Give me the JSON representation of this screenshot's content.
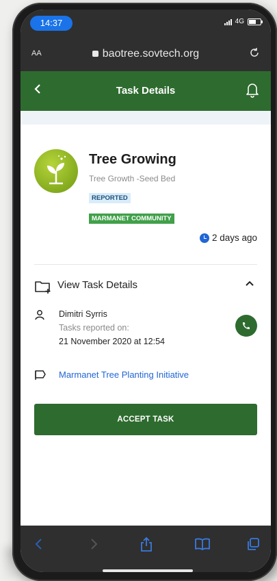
{
  "status_bar": {
    "time": "14:37",
    "network": "4G"
  },
  "browser": {
    "text_size_label": "AA",
    "url": "baotree.sovtech.org"
  },
  "header": {
    "title": "Task Details"
  },
  "task": {
    "title": "Tree Growing",
    "subtitle": "Tree Growth -Seed Bed",
    "status_badge": "REPORTED",
    "community_badge": "MARMANET COMMUNITY",
    "time_ago": "2 days ago"
  },
  "details": {
    "section_label": "View Task Details",
    "reporter_name": "Dimitri Syrris",
    "reported_label": "Tasks reported on:",
    "reported_date": "21 November 2020 at 12:54",
    "project_link": "Marmanet Tree Planting Initiative"
  },
  "actions": {
    "accept_label": "ACCEPT TASK"
  },
  "colors": {
    "brand_green": "#2e6b2f",
    "link_blue": "#2166d6",
    "badge_reported_bg": "#d9ecf9",
    "badge_community_bg": "#41a04a",
    "time_pill": "#1a73e8"
  },
  "icons": {
    "back": "chevron-left-icon",
    "notifications": "bell-icon",
    "avatar": "plant-icon",
    "clock": "clock-icon",
    "section": "folder-add-icon",
    "collapse": "chevron-up-icon",
    "reporter": "user-icon",
    "call": "phone-icon",
    "project": "flag-icon",
    "browser_back": "chevron-left-icon",
    "browser_forward": "chevron-right-icon",
    "share": "share-icon",
    "bookmarks": "book-icon",
    "tabs": "tabs-icon"
  }
}
